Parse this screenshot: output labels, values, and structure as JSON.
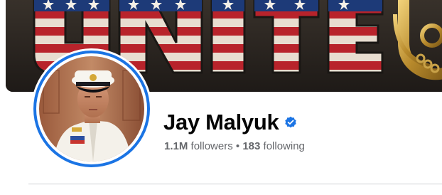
{
  "profile": {
    "name": "Jay Malyuk",
    "verified": true,
    "followers": "1.1M",
    "followers_label": "followers",
    "separator": "•",
    "following": "183",
    "following_label": "following"
  },
  "colors": {
    "accent": "#1b74e4",
    "name_text": "#050505",
    "secondary_text": "#65676b",
    "divider": "#ced0d4"
  },
  "icons": {
    "verified": "verified-badge-icon"
  }
}
